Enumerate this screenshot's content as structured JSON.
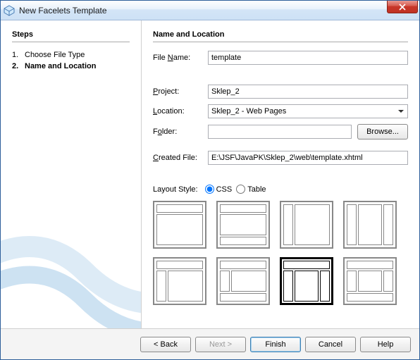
{
  "window": {
    "title": "New Facelets Template"
  },
  "sidebar": {
    "heading": "Steps",
    "steps": [
      {
        "num": "1.",
        "label": "Choose File Type",
        "current": false
      },
      {
        "num": "2.",
        "label": "Name and Location",
        "current": true
      }
    ]
  },
  "main": {
    "heading": "Name and Location",
    "fileName": {
      "label": "File Name:",
      "value": "template"
    },
    "project": {
      "label": "Project:",
      "value": "Sklep_2"
    },
    "location": {
      "label": "Location:",
      "value": "Sklep_2 - Web Pages"
    },
    "folder": {
      "label": "Folder:",
      "value": "",
      "browse": "Browse..."
    },
    "createdFile": {
      "label": "Created File:",
      "value": "E:\\JSF\\JavaPK\\Sklep_2\\web\\template.xhtml"
    },
    "layoutStyle": {
      "label": "Layout Style:",
      "css": "CSS",
      "table": "Table",
      "selected": "css"
    },
    "layouts": {
      "selectedIndex": 6,
      "items": [
        {
          "id": "header-only"
        },
        {
          "id": "header-footer"
        },
        {
          "id": "left-col"
        },
        {
          "id": "left-right-col"
        },
        {
          "id": "header-left"
        },
        {
          "id": "header-left-footer"
        },
        {
          "id": "header-left-right"
        },
        {
          "id": "header-left-right-footer"
        }
      ]
    }
  },
  "footer": {
    "back": "< Back",
    "next": "Next >",
    "finish": "Finish",
    "cancel": "Cancel",
    "help": "Help"
  }
}
